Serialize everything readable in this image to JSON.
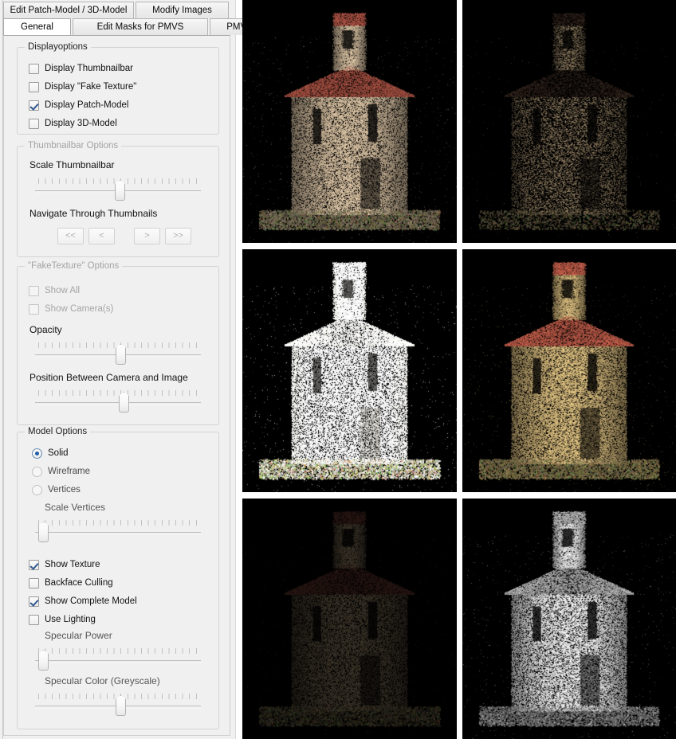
{
  "window": {
    "title": "Edit Patch-Model / 3D-Model"
  },
  "tabs": {
    "row1": [
      {
        "label": "Edit Patch-Model / 3D-Model",
        "active": false
      },
      {
        "label": "Modify Images",
        "active": false
      }
    ],
    "row2": [
      {
        "label": "General",
        "active": true
      },
      {
        "label": "Edit Masks for PMVS",
        "active": false
      },
      {
        "label": "PMVS",
        "active": false
      }
    ]
  },
  "display_options": {
    "title": "Displayoptions",
    "items": [
      {
        "label": "Display Thumbnailbar",
        "checked": false,
        "enabled": true
      },
      {
        "label": "Display \"Fake Texture\"",
        "checked": false,
        "enabled": true
      },
      {
        "label": "Display Patch-Model",
        "checked": true,
        "enabled": true
      },
      {
        "label": "Display 3D-Model",
        "checked": false,
        "enabled": true
      }
    ]
  },
  "thumbnailbar_options": {
    "title": "Thumbnailbar Options",
    "enabled": false,
    "scale_label": "Scale Thumbnailbar",
    "scale_value_pct": 50,
    "navigate_label": "Navigate Through Thumbnails",
    "buttons": [
      {
        "label": "<<",
        "name": "first"
      },
      {
        "label": "<",
        "name": "previous"
      },
      {
        "label": ">",
        "name": "next"
      },
      {
        "label": ">>",
        "name": "last"
      }
    ]
  },
  "fake_texture_options": {
    "title": "\"FakeTexture\" Options",
    "enabled": false,
    "checkboxes": [
      {
        "label": "Show All",
        "checked": false,
        "enabled": false
      },
      {
        "label": "Show Camera(s)",
        "checked": false,
        "enabled": false
      }
    ],
    "opacity_label": "Opacity",
    "opacity_value_pct": 50,
    "position_label": "Position Between Camera and Image",
    "position_value_pct": 52
  },
  "model_options": {
    "title": "Model Options",
    "render_mode": "Solid",
    "radios": [
      {
        "label": "Solid",
        "selected": true
      },
      {
        "label": "Wireframe",
        "selected": false
      },
      {
        "label": "Vertices",
        "selected": false
      }
    ],
    "scale_vertices_label": "Scale Vertices",
    "scale_vertices_value_pct": 2,
    "checkboxes": [
      {
        "label": "Show Texture",
        "checked": true,
        "enabled": true
      },
      {
        "label": "Backface Culling",
        "checked": false,
        "enabled": true
      },
      {
        "label": "Show Complete Model",
        "checked": true,
        "enabled": true
      },
      {
        "label": "Use Lighting",
        "checked": false,
        "enabled": true
      }
    ],
    "specular_power_label": "Specular Power",
    "specular_power_value_pct": 2,
    "specular_color_label": "Specular Color (Greyscale)",
    "specular_color_value_pct": 50
  },
  "viewports": [
    {
      "name": "patch-model-textured-front",
      "description": "Dense textured patch-model of a romanesque rotunda chapel, front view",
      "background": "#000000",
      "style": "dense-color",
      "density": 1.0,
      "brightness": 1.0,
      "tint": "#b5a288",
      "roof_color": "#8d4438"
    },
    {
      "name": "patch-model-sparse-dark",
      "description": "Sparse dark point cloud of the same chapel",
      "background": "#000000",
      "style": "sparse-color",
      "density": 0.34,
      "brightness": 0.75,
      "tint": "#a08b6b",
      "roof_color": "#3a2a22"
    },
    {
      "name": "patch-model-overexposed",
      "description": "Bright over-exposed point cloud rendering of the chapel",
      "background": "#000000",
      "style": "dense-bright",
      "density": 0.9,
      "brightness": 1.85,
      "tint": "#e8e6de",
      "roof_color": "#cfc8bc"
    },
    {
      "name": "patch-model-textured-angled",
      "description": "Textured patch-model, slightly rotated view with red roof tiles",
      "background": "#000000",
      "style": "dense-color",
      "density": 0.95,
      "brightness": 1.1,
      "tint": "#a89262",
      "roof_color": "#97493a"
    },
    {
      "name": "patch-model-dim",
      "description": "Dim low-light textured point cloud of the chapel",
      "background": "#000000",
      "style": "dense-color",
      "density": 0.8,
      "brightness": 0.45,
      "tint": "#6a5c48",
      "roof_color": "#4a2a24"
    },
    {
      "name": "patch-model-greyscale",
      "description": "Greyscale lighting-only rendering of the chapel point cloud",
      "background": "#000000",
      "style": "greyscale",
      "density": 0.85,
      "brightness": 1.0,
      "tint": "#cfcfcf",
      "roof_color": "#9a9a9a"
    }
  ],
  "colors": {
    "panel_background": "#f0f0f0",
    "tab_active": "#ffffff",
    "group_border": "#d3d3d3",
    "checkbox_check": "#30598f",
    "radio_dot": "#1f5fa8",
    "viewport_background": "#000000"
  }
}
